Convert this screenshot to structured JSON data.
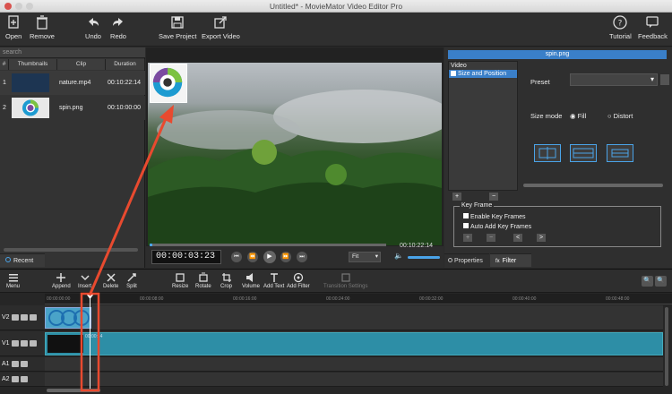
{
  "window": {
    "title": "Untitled* - MovieMator Video Editor Pro"
  },
  "toolbar": {
    "open": "Open",
    "remove": "Remove",
    "undo": "Undo",
    "redo": "Redo",
    "save_project": "Save Project",
    "export_video": "Export Video",
    "tutorial": "Tutorial",
    "feedback": "Feedback"
  },
  "library": {
    "search_placeholder": "search",
    "columns": [
      "#",
      "Thumbnails",
      "Clip",
      "Duration"
    ],
    "rows": [
      {
        "index": "1",
        "clip": "nature.mp4",
        "duration": "00:10:22:14"
      },
      {
        "index": "2",
        "clip": "spin.png",
        "duration": "00:10:00:00"
      }
    ],
    "recent_tab": "Recent"
  },
  "preview": {
    "timecode": "00:00:03:23",
    "end_timecode": "00:10:22:14",
    "zoom": "Fit"
  },
  "filter_panel": {
    "clip_title": "spin.png",
    "category": "Video",
    "filter_item": "Size and Position",
    "preset_label": "Preset",
    "size_mode_label": "Size mode",
    "fill_label": "Fill",
    "distort_label": "Distort",
    "add_label": "+",
    "remove_label": "−",
    "keyframe_group": "Key Frame",
    "enable_keyframes": "Enable Key Frames",
    "auto_add_keyframes": "Auto Add Key Frames",
    "kf_add": "+",
    "kf_remove": "−",
    "kf_prev": "<",
    "kf_next": ">",
    "tab_properties": "Properties",
    "tab_filter": "Filter"
  },
  "timeline": {
    "menu": "Menu",
    "append": "Append",
    "insert": "Insert",
    "delete": "Delete",
    "split": "Split",
    "resize": "Resize",
    "rotate": "Rotate",
    "crop": "Crop",
    "volume": "Volume",
    "add_text": "Add Text",
    "add_filter": "Add Filter",
    "transition_settings": "Transition Settings",
    "ruler_ticks": [
      "00:00:00:00",
      "00:00:08:00",
      "00:00:16:00",
      "00:00:24:00",
      "00:00:32:00",
      "00:00:40:00",
      "00:00:48:00"
    ],
    "tracks": [
      "V2",
      "V1",
      "A1",
      "A2"
    ],
    "clip_label_v1": "00:00:14"
  },
  "colors": {
    "accent": "#3a7fc8",
    "annotation": "#e84a2f",
    "clip_teal": "#2d8ea6"
  }
}
